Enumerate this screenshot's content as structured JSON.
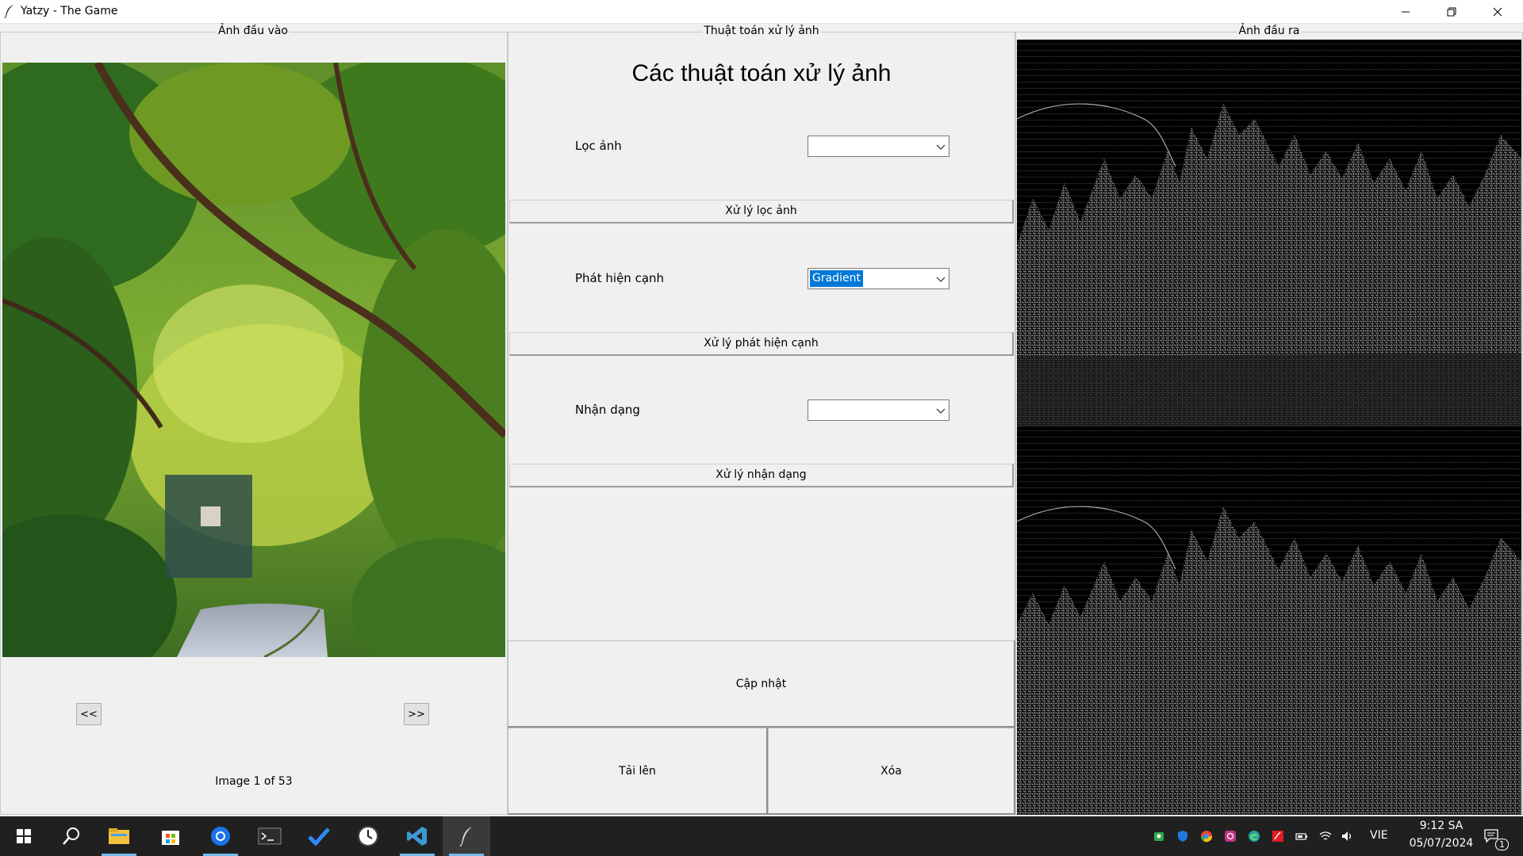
{
  "window": {
    "title": "Yatzy - The Game"
  },
  "input_panel": {
    "label": "Ảnh đầu vào",
    "prev_label": "<<",
    "next_label": ">>",
    "counter": "Image 1 of 53"
  },
  "algo_panel": {
    "label": "Thuật toán xử lý ảnh",
    "heading": "Các thuật toán xử lý ảnh",
    "filter": {
      "label": "Lọc ảnh",
      "value": "",
      "button": "Xử lý lọc ảnh"
    },
    "edge": {
      "label": "Phát hiện cạnh",
      "value": "Gradient",
      "button": "Xử lý phát hiện cạnh"
    },
    "recognize": {
      "label": "Nhận dạng",
      "value": "",
      "button": "Xử lý nhận dạng"
    },
    "update_button": "Cập nhật",
    "upload_button": "Tải lên",
    "delete_button": "Xóa"
  },
  "output_panel": {
    "label": "Ảnh đầu ra"
  },
  "taskbar": {
    "apps": [
      "start-icon",
      "search-icon",
      "file-explorer-icon",
      "store-icon",
      "browser-icon",
      "terminal-icon",
      "todo-icon",
      "clock-icon",
      "vscode-icon",
      "feather-app-icon"
    ],
    "language": "VIE",
    "time": "9:12 SA",
    "date": "05/07/2024",
    "notification_count": "1"
  },
  "colors": {
    "selection": "#0078d7",
    "taskbar": "#202020",
    "window_bg": "#f0f0f0"
  }
}
